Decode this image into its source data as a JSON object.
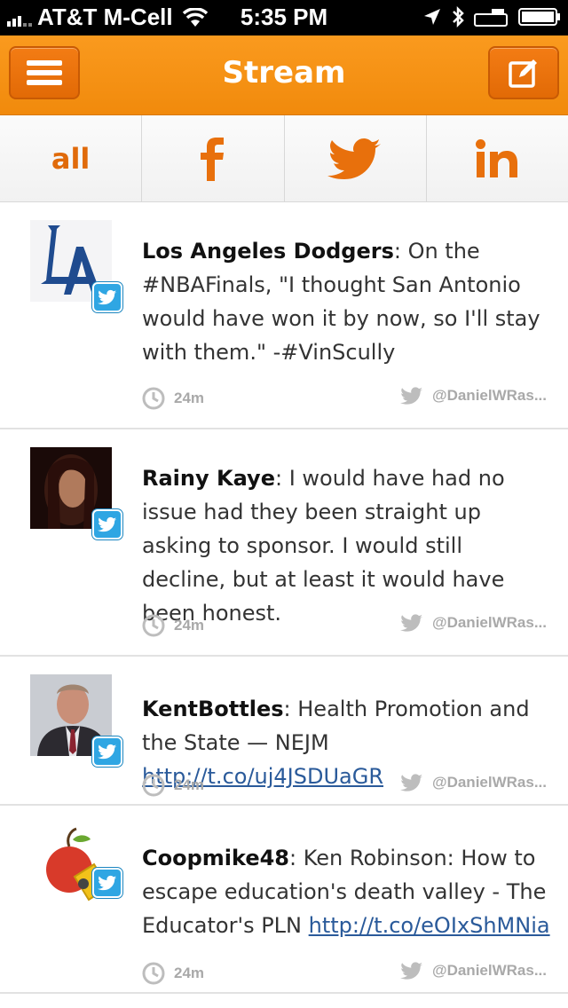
{
  "status_bar": {
    "carrier": "AT&T M-Cell",
    "time": "5:35 PM"
  },
  "navbar": {
    "title": "Stream"
  },
  "tabs": {
    "all_label": "all"
  },
  "posts": [
    {
      "author": "Los Angeles Dodgers",
      "text": "On the #NBAFinals, \"I thought San Antonio would have won it by now, so I'll stay with them.\" -#VinScully",
      "link": "",
      "time": "24m",
      "account": "@DanielWRas..."
    },
    {
      "author": "Rainy Kaye",
      "text": "I would have had no issue had they been straight up asking to sponsor. I would still decline, but at least it would have been honest.",
      "link": "",
      "time": "24m",
      "account": "@DanielWRas..."
    },
    {
      "author": "KentBottles",
      "text": "Health Promotion and the State — NEJM",
      "link": "http://t.co/uj4JSDUaGR",
      "time": "24m",
      "account": "@DanielWRas..."
    },
    {
      "author": "Coopmike48",
      "text": "Ken Robinson: How to escape education's death valley - The Educator's PLN",
      "link": "http://t.co/eOIxShMNia",
      "time": "24m",
      "account": "@DanielWRas..."
    }
  ],
  "colors": {
    "accent": "#f18a0c",
    "twitter_blue": "#2fa6e3"
  }
}
